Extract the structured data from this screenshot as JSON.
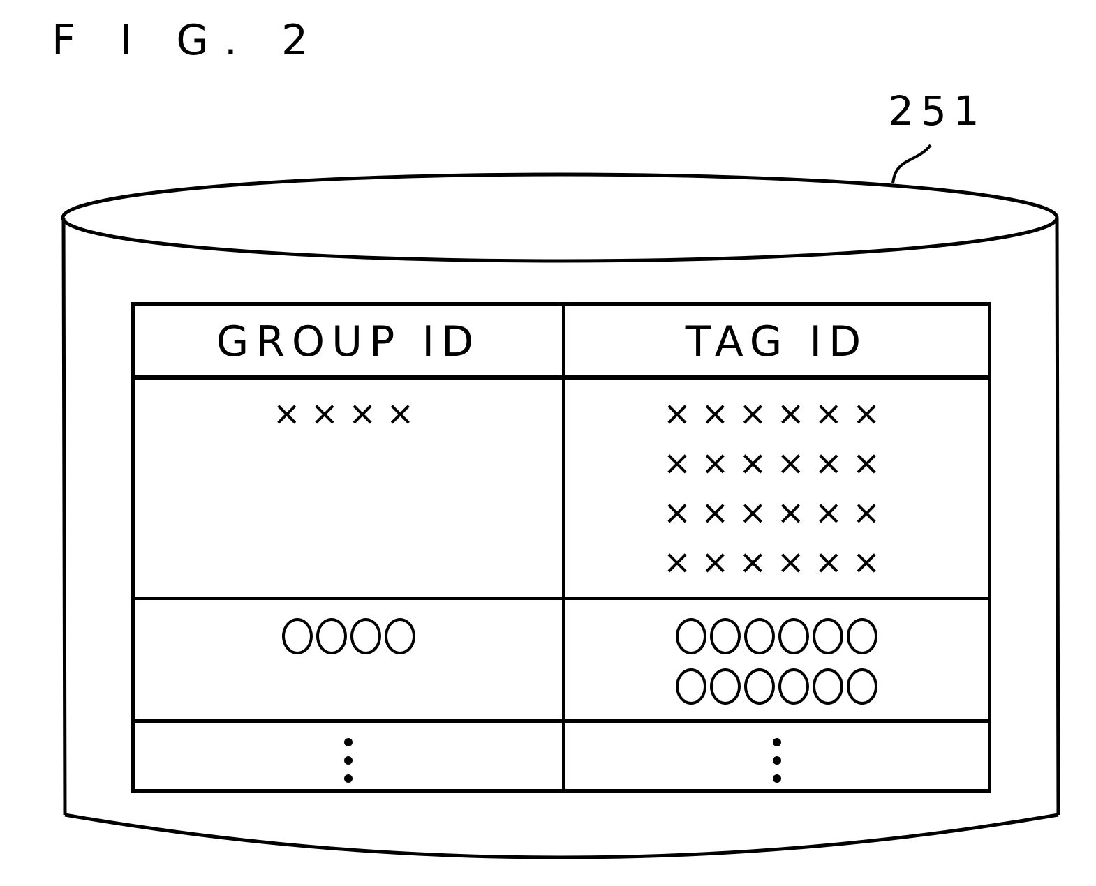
{
  "figure": {
    "label": "F I G. 2",
    "reference_number": "251"
  },
  "table": {
    "headers": [
      "GROUP ID",
      "TAG ID"
    ],
    "rows": [
      {
        "group_id": "××××",
        "tag_id_lines": [
          "××××××",
          "××××××",
          "××××××",
          "××××××"
        ],
        "symbol": "cross"
      },
      {
        "group_id_ovals": 4,
        "tag_id_ovals_per_line": 6,
        "tag_id_lines": 2,
        "symbol": "oval"
      },
      {
        "group_id": "ellipsis",
        "tag_id": "ellipsis"
      }
    ]
  }
}
